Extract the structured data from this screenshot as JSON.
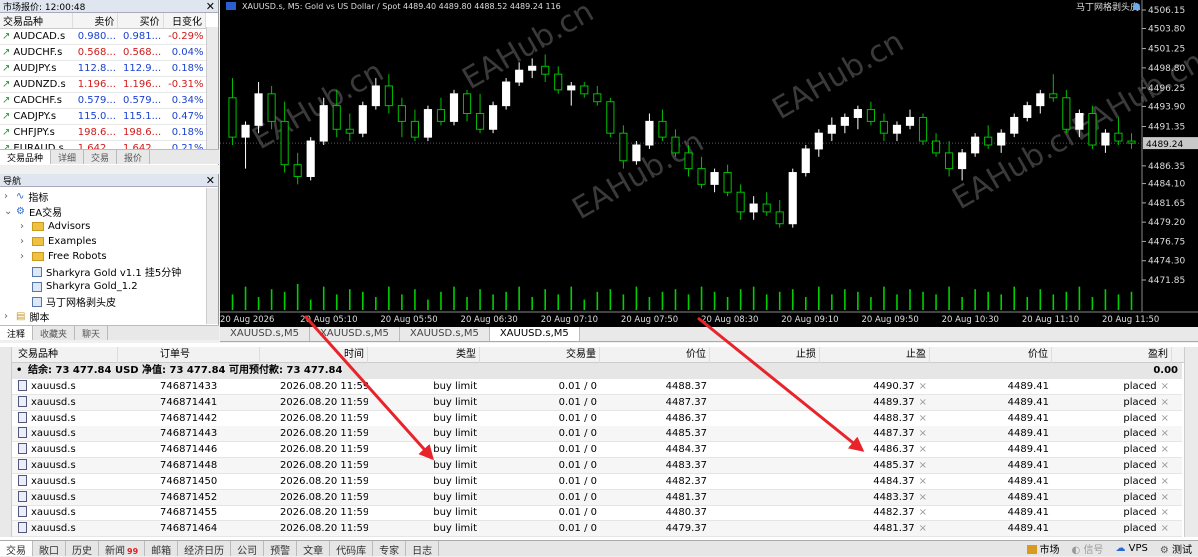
{
  "market_watch": {
    "title": "市场报价: 12:00:48",
    "columns": [
      "交易品种",
      "卖价",
      "买价",
      "日变化"
    ],
    "rows": [
      {
        "symbol": "AUDCAD.s",
        "bid": "0.980...",
        "ask": "0.981...",
        "change": "-0.29%",
        "dir": "up",
        "color": "#1a3fd0",
        "chg_color": "#d01a1a"
      },
      {
        "symbol": "AUDCHF.s",
        "bid": "0.568...",
        "ask": "0.568...",
        "change": "0.04%",
        "dir": "up",
        "color": "#d01a1a",
        "chg_color": "#1a3fd0"
      },
      {
        "symbol": "AUDJPY.s",
        "bid": "112.8...",
        "ask": "112.9...",
        "change": "0.18%",
        "dir": "up",
        "color": "#1a3fd0",
        "chg_color": "#1a3fd0"
      },
      {
        "symbol": "AUDNZD.s",
        "bid": "1.196...",
        "ask": "1.196...",
        "change": "-0.31%",
        "dir": "up",
        "color": "#d01a1a",
        "chg_color": "#d01a1a"
      },
      {
        "symbol": "CADCHF.s",
        "bid": "0.579...",
        "ask": "0.579...",
        "change": "0.34%",
        "dir": "up",
        "color": "#1a3fd0",
        "chg_color": "#1a3fd0"
      },
      {
        "symbol": "CADJPY.s",
        "bid": "115.0...",
        "ask": "115.1...",
        "change": "0.47%",
        "dir": "up",
        "color": "#1a3fd0",
        "chg_color": "#1a3fd0"
      },
      {
        "symbol": "CHFJPY.s",
        "bid": "198.6...",
        "ask": "198.6...",
        "change": "0.18%",
        "dir": "up",
        "color": "#d01a1a",
        "chg_color": "#1a3fd0"
      },
      {
        "symbol": "EURAUD.s",
        "bid": "1.642...",
        "ask": "1.642...",
        "change": "0.21%",
        "dir": "up",
        "color": "#d01a1a",
        "chg_color": "#1a3fd0"
      }
    ],
    "tabs": [
      "交易品种",
      "详细",
      "交易",
      "报价"
    ]
  },
  "navigator": {
    "title": "导航",
    "items": [
      {
        "label": "指标",
        "type": "indicator",
        "depth": 0
      },
      {
        "label": "EA交易",
        "type": "ea",
        "depth": 0
      },
      {
        "label": "Advisors",
        "type": "folder",
        "depth": 1
      },
      {
        "label": "Examples",
        "type": "folder",
        "depth": 1
      },
      {
        "label": "Free Robots",
        "type": "folder",
        "depth": 1
      },
      {
        "label": "Sharkyra Gold v1.1 挂5分钟",
        "type": "robot",
        "depth": 1
      },
      {
        "label": "Sharkyra Gold_1.2",
        "type": "robot",
        "depth": 1
      },
      {
        "label": "马丁网格剥头皮",
        "type": "robot",
        "depth": 1
      },
      {
        "label": "脚本",
        "type": "script",
        "depth": 0
      }
    ],
    "tabs": [
      "注释",
      "收藏夹",
      "聊天"
    ]
  },
  "chart": {
    "header": "XAUUSD.s, M5:  Gold vs US Dollar / Spot  4489.40 4489.80 4488.52 4489.24  116",
    "ea_label": "马丁网格剥头皮",
    "price_labels": [
      "4506.15",
      "4503.80",
      "4501.25",
      "4498.80",
      "4496.25",
      "4493.90",
      "4491.35",
      "4489.24",
      "4486.35",
      "4484.10",
      "4481.65",
      "4479.20",
      "4476.75",
      "4474.30",
      "4471.85"
    ],
    "current_price": "4489.24",
    "time_labels": [
      "20 Aug 2026",
      "20 Aug 05:10",
      "20 Aug 05:50",
      "20 Aug 06:30",
      "20 Aug 07:10",
      "20 Aug 07:50",
      "20 Aug 08:30",
      "20 Aug 09:10",
      "20 Aug 09:50",
      "20 Aug 10:30",
      "20 Aug 11:10",
      "20 Aug 11:50"
    ],
    "tabs": [
      "XAUUSD.s,M5",
      "XAUUSD.s,M5",
      "XAUUSD.s,M5",
      "XAUUSD.s,M5"
    ],
    "watermarks": [
      "EAHub.cn",
      "EAHub.cn",
      "EAHub.cn",
      "EAHub.cn",
      "EAHub.cn",
      "EAHub.cn"
    ],
    "colors": {
      "bull": "#ffffff",
      "bear": "#00c000",
      "bg": "#000000",
      "volume": "#00d000"
    },
    "candles": [
      [
        4495.0,
        4497.5,
        4489.0,
        4490.0
      ],
      [
        4490.0,
        4492.0,
        4486.0,
        4491.5
      ],
      [
        4491.5,
        4497.0,
        4490.5,
        4495.5
      ],
      [
        4495.5,
        4496.5,
        4491.0,
        4492.0
      ],
      [
        4492.0,
        4494.5,
        4485.5,
        4486.5
      ],
      [
        4486.5,
        4488.0,
        4484.0,
        4485.0
      ],
      [
        4485.0,
        4490.0,
        4484.5,
        4489.5
      ],
      [
        4489.5,
        4495.0,
        4489.0,
        4494.0
      ],
      [
        4494.0,
        4496.0,
        4490.0,
        4491.0
      ],
      [
        4491.0,
        4493.0,
        4489.5,
        4490.5
      ],
      [
        4490.5,
        4494.5,
        4490.0,
        4494.0
      ],
      [
        4494.0,
        4497.5,
        4493.5,
        4496.5
      ],
      [
        4496.5,
        4498.0,
        4493.0,
        4494.0
      ],
      [
        4494.0,
        4495.0,
        4490.0,
        4492.0
      ],
      [
        4492.0,
        4493.5,
        4489.5,
        4490.0
      ],
      [
        4490.0,
        4494.0,
        4489.5,
        4493.5
      ],
      [
        4493.5,
        4495.0,
        4491.5,
        4492.0
      ],
      [
        4492.0,
        4496.0,
        4491.5,
        4495.5
      ],
      [
        4495.5,
        4496.0,
        4492.0,
        4493.0
      ],
      [
        4493.0,
        4495.5,
        4490.5,
        4491.0
      ],
      [
        4491.0,
        4494.5,
        4490.5,
        4494.0
      ],
      [
        4494.0,
        4497.5,
        4493.5,
        4497.0
      ],
      [
        4497.0,
        4499.5,
        4496.5,
        4498.5
      ],
      [
        4498.5,
        4500.0,
        4497.5,
        4499.0
      ],
      [
        4499.0,
        4500.5,
        4497.0,
        4498.0
      ],
      [
        4498.0,
        4499.0,
        4495.5,
        4496.0
      ],
      [
        4496.0,
        4497.0,
        4494.0,
        4496.5
      ],
      [
        4496.5,
        4497.0,
        4495.0,
        4495.5
      ],
      [
        4495.5,
        4496.5,
        4494.0,
        4494.5
      ],
      [
        4494.5,
        4495.0,
        4490.0,
        4490.5
      ],
      [
        4490.5,
        4491.5,
        4486.0,
        4487.0
      ],
      [
        4487.0,
        4489.5,
        4486.5,
        4489.0
      ],
      [
        4489.0,
        4493.0,
        4488.5,
        4492.0
      ],
      [
        4492.0,
        4493.5,
        4489.5,
        4490.0
      ],
      [
        4490.0,
        4491.0,
        4487.5,
        4488.0
      ],
      [
        4488.0,
        4489.0,
        4485.0,
        4486.0
      ],
      [
        4486.0,
        4487.5,
        4483.5,
        4484.0
      ],
      [
        4484.0,
        4486.0,
        4483.0,
        4485.5
      ],
      [
        4485.5,
        4486.5,
        4482.5,
        4483.0
      ],
      [
        4483.0,
        4484.0,
        4479.5,
        4480.5
      ],
      [
        4480.5,
        4482.5,
        4479.5,
        4481.5
      ],
      [
        4481.5,
        4483.0,
        4480.0,
        4480.5
      ],
      [
        4480.5,
        4482.0,
        4478.5,
        4479.0
      ],
      [
        4479.0,
        4486.0,
        4478.5,
        4485.5
      ],
      [
        4485.5,
        4489.0,
        4485.0,
        4488.5
      ],
      [
        4488.5,
        4491.0,
        4487.5,
        4490.5
      ],
      [
        4490.5,
        4492.5,
        4489.5,
        4491.5
      ],
      [
        4491.5,
        4493.0,
        4490.5,
        4492.5
      ],
      [
        4492.5,
        4494.0,
        4491.0,
        4493.5
      ],
      [
        4493.5,
        4494.5,
        4491.5,
        4492.0
      ],
      [
        4492.0,
        4493.0,
        4489.5,
        4490.5
      ],
      [
        4490.5,
        4492.0,
        4489.5,
        4491.5
      ],
      [
        4491.5,
        4493.5,
        4491.0,
        4492.5
      ],
      [
        4492.5,
        4493.0,
        4489.0,
        4489.5
      ],
      [
        4489.5,
        4490.5,
        4487.5,
        4488.0
      ],
      [
        4488.0,
        4489.5,
        4485.0,
        4486.0
      ],
      [
        4486.0,
        4488.5,
        4484.5,
        4488.0
      ],
      [
        4488.0,
        4490.5,
        4487.5,
        4490.0
      ],
      [
        4490.0,
        4491.5,
        4488.5,
        4489.0
      ],
      [
        4489.0,
        4491.0,
        4488.0,
        4490.5
      ],
      [
        4490.5,
        4493.0,
        4490.0,
        4492.5
      ],
      [
        4492.5,
        4494.5,
        4492.0,
        4494.0
      ],
      [
        4494.0,
        4496.0,
        4493.0,
        4495.5
      ],
      [
        4495.5,
        4498.0,
        4494.5,
        4495.0
      ],
      [
        4495.0,
        4496.0,
        4490.5,
        4491.0
      ],
      [
        4491.0,
        4493.5,
        4490.0,
        4493.0
      ],
      [
        4493.0,
        4494.0,
        4488.5,
        4489.0
      ],
      [
        4489.0,
        4491.0,
        4488.0,
        4490.5
      ],
      [
        4490.5,
        4492.5,
        4489.0,
        4489.5
      ],
      [
        4489.5,
        4490.5,
        4488.5,
        4489.24
      ]
    ],
    "volumes": [
      6,
      9,
      5,
      8,
      7,
      10,
      4,
      9,
      6,
      8,
      7,
      5,
      9,
      6,
      8,
      4,
      7,
      9,
      5,
      8,
      6,
      7,
      9,
      5,
      8,
      6,
      9,
      4,
      7,
      8,
      6,
      9,
      5,
      7,
      8,
      6,
      9,
      7,
      5,
      8,
      9,
      6,
      7,
      8,
      5,
      9,
      6,
      8,
      7,
      5,
      9,
      6,
      8,
      7,
      6,
      9,
      5,
      8,
      7,
      6,
      9,
      5,
      8,
      6,
      7,
      9,
      5,
      8,
      6,
      7
    ]
  },
  "terminal": {
    "columns": [
      "交易品种",
      "订单号",
      "时间",
      "类型",
      "交易量",
      "价位",
      "止损",
      "止盈",
      "价位",
      "盈利"
    ],
    "summary": {
      "text": "结余: 73 477.84 USD  净值: 73 477.84  可用预付款: 73 477.84",
      "profit": "0.00"
    },
    "rows": [
      {
        "symbol": "xauusd.s",
        "ticket": "746871433",
        "time": "2026.08.20 11:59:52",
        "type": "buy limit",
        "volume": "0.01 / 0",
        "price": "4488.37",
        "sl": "",
        "tp": "4490.37",
        "cur": "4489.41",
        "state": "placed"
      },
      {
        "symbol": "xauusd.s",
        "ticket": "746871441",
        "time": "2026.08.20 11:59:52",
        "type": "buy limit",
        "volume": "0.01 / 0",
        "price": "4487.37",
        "sl": "",
        "tp": "4489.37",
        "cur": "4489.41",
        "state": "placed"
      },
      {
        "symbol": "xauusd.s",
        "ticket": "746871442",
        "time": "2026.08.20 11:59:52",
        "type": "buy limit",
        "volume": "0.01 / 0",
        "price": "4486.37",
        "sl": "",
        "tp": "4488.37",
        "cur": "4489.41",
        "state": "placed"
      },
      {
        "symbol": "xauusd.s",
        "ticket": "746871443",
        "time": "2026.08.20 11:59:52",
        "type": "buy limit",
        "volume": "0.01 / 0",
        "price": "4485.37",
        "sl": "",
        "tp": "4487.37",
        "cur": "4489.41",
        "state": "placed"
      },
      {
        "symbol": "xauusd.s",
        "ticket": "746871446",
        "time": "2026.08.20 11:59:53",
        "type": "buy limit",
        "volume": "0.01 / 0",
        "price": "4484.37",
        "sl": "",
        "tp": "4486.37",
        "cur": "4489.41",
        "state": "placed"
      },
      {
        "symbol": "xauusd.s",
        "ticket": "746871448",
        "time": "2026.08.20 11:59:53",
        "type": "buy limit",
        "volume": "0.01 / 0",
        "price": "4483.37",
        "sl": "",
        "tp": "4485.37",
        "cur": "4489.41",
        "state": "placed"
      },
      {
        "symbol": "xauusd.s",
        "ticket": "746871450",
        "time": "2026.08.20 11:59:53",
        "type": "buy limit",
        "volume": "0.01 / 0",
        "price": "4482.37",
        "sl": "",
        "tp": "4484.37",
        "cur": "4489.41",
        "state": "placed"
      },
      {
        "symbol": "xauusd.s",
        "ticket": "746871452",
        "time": "2026.08.20 11:59:53",
        "type": "buy limit",
        "volume": "0.01 / 0",
        "price": "4481.37",
        "sl": "",
        "tp": "4483.37",
        "cur": "4489.41",
        "state": "placed"
      },
      {
        "symbol": "xauusd.s",
        "ticket": "746871455",
        "time": "2026.08.20 11:59:53",
        "type": "buy limit",
        "volume": "0.01 / 0",
        "price": "4480.37",
        "sl": "",
        "tp": "4482.37",
        "cur": "4489.41",
        "state": "placed"
      },
      {
        "symbol": "xauusd.s",
        "ticket": "746871464",
        "time": "2026.08.20 11:59:53",
        "type": "buy limit",
        "volume": "0.01 / 0",
        "price": "4479.37",
        "sl": "",
        "tp": "4481.37",
        "cur": "4489.41",
        "state": "placed"
      }
    ],
    "close_glyph": "×",
    "bottom_tabs": [
      {
        "label": "交易",
        "badge": ""
      },
      {
        "label": "敞口",
        "badge": ""
      },
      {
        "label": "历史",
        "badge": ""
      },
      {
        "label": "新闻",
        "badge": "99"
      },
      {
        "label": "邮箱",
        "badge": ""
      },
      {
        "label": "经济日历",
        "badge": ""
      },
      {
        "label": "公司",
        "badge": ""
      },
      {
        "label": "预警",
        "badge": ""
      },
      {
        "label": "文章",
        "badge": ""
      },
      {
        "label": "代码库",
        "badge": ""
      },
      {
        "label": "专家",
        "badge": ""
      },
      {
        "label": "日志",
        "badge": ""
      }
    ],
    "status": {
      "market": "市场",
      "signal": "信号",
      "vps": "VPS",
      "test": "测试"
    }
  },
  "annotation": {
    "color": "#e8242a"
  }
}
